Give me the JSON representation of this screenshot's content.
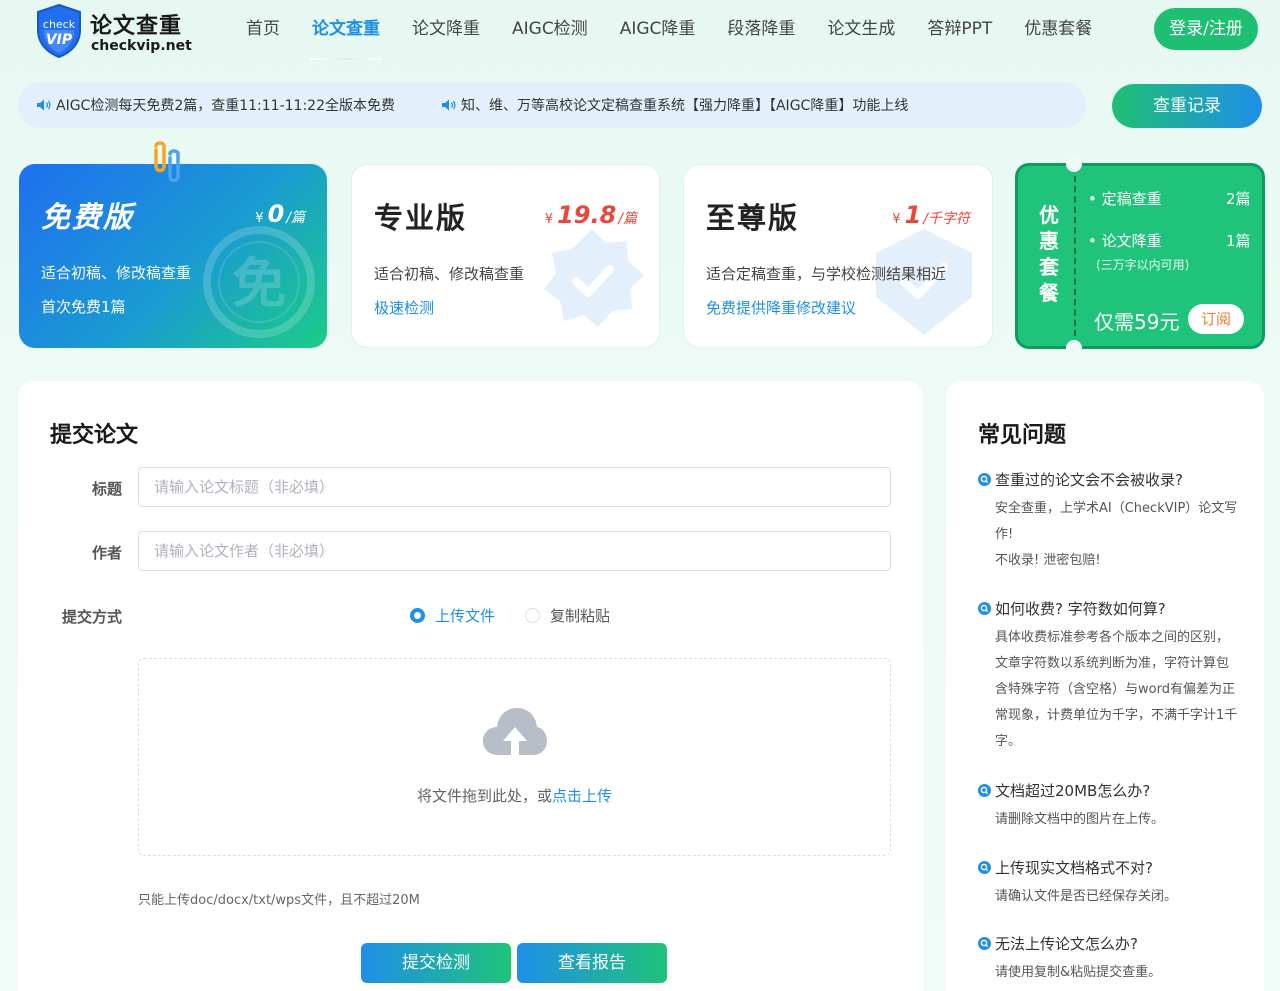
{
  "brand": {
    "logo_badge_top": "check",
    "logo_badge_bottom": "VIP",
    "title": "论文查重",
    "domain": "checkvip.net"
  },
  "nav": {
    "items": [
      {
        "label": "首页"
      },
      {
        "label": "论文查重"
      },
      {
        "label": "论文降重"
      },
      {
        "label": "AIGC检测"
      },
      {
        "label": "AIGC降重"
      },
      {
        "label": "段落降重"
      },
      {
        "label": "论文生成"
      },
      {
        "label": "答辩PPT"
      },
      {
        "label": "优惠套餐"
      }
    ],
    "active_index": 1,
    "login_label": "登录/注册"
  },
  "notice": {
    "items": [
      "AIGC检测每天免费2篇，查重11:11-11:22全版本免费",
      "知、维、万等高校论文定稿查重系统【强力降重】【AIGC降重】功能上线"
    ],
    "record_button": "查重记录"
  },
  "plans": {
    "free": {
      "name": "免费版",
      "currency": "¥",
      "price": "0",
      "unit": "/篇",
      "desc": "适合初稿、修改稿查重",
      "sub": "首次免费1篇",
      "seal_char": "免"
    },
    "pro": {
      "name": "专业版",
      "currency": "¥",
      "price": "19.8",
      "unit": "/篇",
      "desc": "适合初稿、修改稿查重",
      "sub": "极速检测"
    },
    "ultimate": {
      "name": "至尊版",
      "currency": "¥",
      "price": "1",
      "unit": "/千字符",
      "desc": "适合定稿查重，与学校检测结果相近",
      "sub": "免费提供降重修改建议"
    }
  },
  "combo": {
    "title": "优惠套餐",
    "title_chars": [
      "优",
      "惠",
      "套",
      "餐"
    ],
    "row1_label": "定稿查重",
    "row1_qty": "2篇",
    "row2_label": "论文降重",
    "row2_qty": "1篇",
    "note": "(三万字以内可用)",
    "price": "仅需59元",
    "subscribe": "订阅"
  },
  "submit": {
    "title": "提交论文",
    "title_label": "标题",
    "title_placeholder": "请输入论文标题（非必填）",
    "author_label": "作者",
    "author_placeholder": "请输入论文作者（非必填）",
    "method_label": "提交方式",
    "method_upload": "上传文件",
    "method_paste": "复制粘贴",
    "method_selected": "上传文件",
    "drop_text": "将文件拖到此处，或",
    "drop_link": "点击上传",
    "hint": "只能上传doc/docx/txt/wps文件，且不超过20M",
    "submit_button": "提交检测",
    "report_button": "查看报告"
  },
  "faq": {
    "title": "常见问题",
    "items": [
      {
        "q": "查重过的论文会不会被收录?",
        "a": [
          "安全查重，上学术AI（CheckVIP）论文写作!",
          "不收录! 泄密包赔!"
        ]
      },
      {
        "q": "如何收费? 字符数如何算?",
        "a": [
          "具体收费标准参考各个版本之间的区别，文章字符数以系统判断为准，字符计算包含特殊字符（含空格）与word有偏差为正常现象，计费单位为千字，不满千字计1千字。"
        ]
      },
      {
        "q": "文档超过20MB怎么办?",
        "a": [
          "请删除文档中的图片在上传。"
        ]
      },
      {
        "q": "上传现实文档格式不对?",
        "a": [
          "请确认文件是否已经保存关闭。"
        ]
      },
      {
        "q": "无法上传论文怎么办?",
        "a": [
          "请使用复制&粘贴提交查重。"
        ]
      }
    ]
  },
  "colors": {
    "accent_blue": "#1f8fe8",
    "accent_green": "#1fc37a",
    "price_red": "#e8473b",
    "subscribe_orange": "#f07a2c"
  }
}
